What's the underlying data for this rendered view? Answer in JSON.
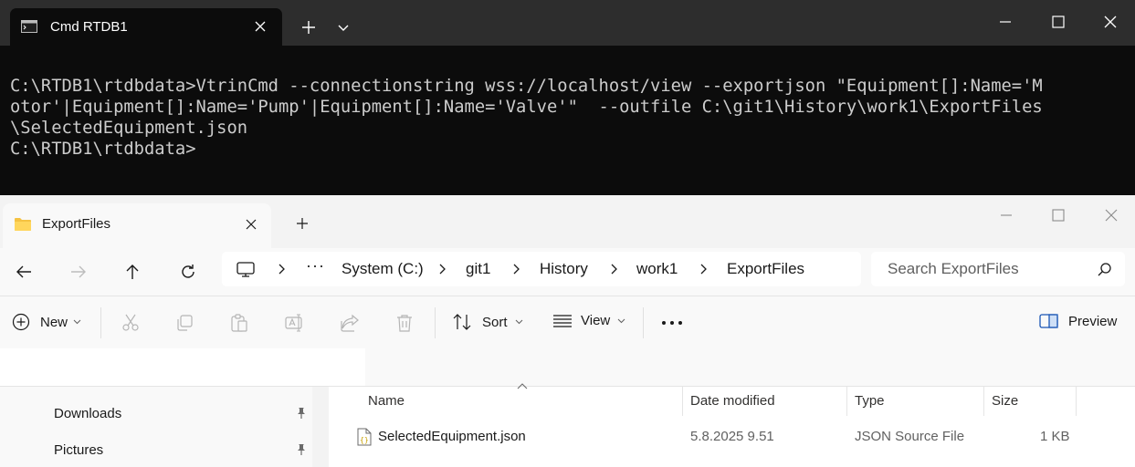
{
  "terminal": {
    "tab_title": "Cmd RTDB1",
    "lines": [
      "C:\\RTDB1\\rtdbdata>VtrinCmd --connectionstring wss://localhost/view --exportjson \"Equipment[]:Name='M",
      "otor'|Equipment[]:Name='Pump'|Equipment[]:Name='Valve'\"  --outfile C:\\git1\\History\\work1\\ExportFiles",
      "\\SelectedEquipment.json",
      "",
      "C:\\RTDB1\\rtdbdata>"
    ]
  },
  "explorer": {
    "tab_title": "ExportFiles",
    "breadcrumb": [
      "System (C:)",
      "git1",
      "History",
      "work1",
      "ExportFiles"
    ],
    "search_placeholder": "Search ExportFiles",
    "commands": {
      "new": "New",
      "sort": "Sort",
      "view": "View",
      "preview": "Preview"
    },
    "nav_items": [
      {
        "label": "Downloads",
        "pinned": true
      },
      {
        "label": "Pictures",
        "pinned": true
      }
    ],
    "columns": [
      "Name",
      "Date modified",
      "Type",
      "Size"
    ],
    "files": [
      {
        "name": "SelectedEquipment.json",
        "date_modified": "5.8.2025 9.51",
        "type": "JSON Source File",
        "size": "1 KB"
      }
    ]
  }
}
